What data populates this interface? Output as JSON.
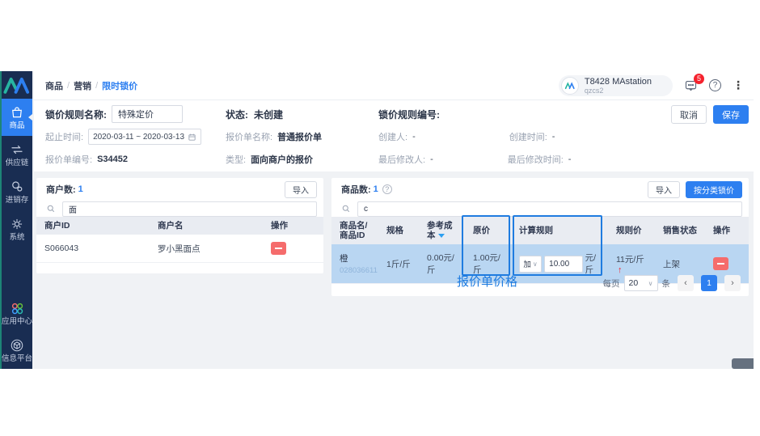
{
  "colors": {
    "accent": "#2d7ff0",
    "sidebar": "#192d52",
    "danger": "#f56c6c",
    "row_highlight": "#b9d6f2",
    "annotation": "#1f7ce0"
  },
  "sidebar": {
    "items": [
      {
        "label": "商品",
        "icon": "bag",
        "active": true
      },
      {
        "label": "供应链",
        "icon": "exchange-arrows",
        "active": false
      },
      {
        "label": "进销存",
        "icon": "nodes",
        "active": false
      },
      {
        "label": "系统",
        "icon": "gear",
        "active": false
      },
      {
        "label": "应用中心",
        "icon": "four-circles",
        "active": false
      },
      {
        "label": "信息平台",
        "icon": "cube",
        "active": false
      }
    ]
  },
  "topbar": {
    "breadcrumb": {
      "0": "商品",
      "1": "营销",
      "2": "限时锁价"
    },
    "user": {
      "name": "T8428 MAstation",
      "sub": "qzcs2"
    },
    "message_badge": "5"
  },
  "form": {
    "rule_name_label": "锁价规则名称:",
    "rule_name_value": "特殊定价",
    "status_label": "状态:",
    "status_value": "未创建",
    "rule_no_label": "锁价规则编号:",
    "date_label": "起止时间:",
    "date_value": "2020-03-11 ~ 2020-03-13",
    "quote_name_label": "报价单名称:",
    "quote_name_value": "普通报价单",
    "creator_label": "创建人:",
    "creator_value": "-",
    "created_label": "创建时间:",
    "created_value": "-",
    "quote_no_label": "报价单编号:",
    "quote_no_value": "S34452",
    "type_label": "类型:",
    "type_value": "面向商户的报价",
    "modifier_label": "最后修改人:",
    "modifier_value": "-",
    "modified_label": "最后修改时间:",
    "modified_value": "-",
    "cancel_label": "取消",
    "save_label": "保存"
  },
  "merchants": {
    "count_label": "商户数:",
    "count": "1",
    "import_label": "导入",
    "search_value": "面",
    "columns": {
      "0": "商户ID",
      "1": "商户名",
      "2": "操作"
    },
    "row": {
      "id": "S066043",
      "name": "罗小黑面点"
    }
  },
  "products": {
    "count_label": "商品数:",
    "count": "1",
    "import_label": "导入",
    "lock_by_category_label": "按分类锁价",
    "search_value": "c",
    "columns": {
      "0": "商品名/商品ID",
      "1": "规格",
      "2": "参考成本",
      "3": "原价",
      "4": "计算规则",
      "5": "规则价",
      "6": "销售状态",
      "7": "操作"
    },
    "row": {
      "name": "橙",
      "id": "028036611",
      "spec": "1斤/斤",
      "cost": "0.00元/斤",
      "original_price": "1.00元/斤",
      "calc_op": "加",
      "calc_value": "10.00",
      "calc_unit": "元/斤",
      "rule_price": "11元/斤",
      "sale_status": "上架"
    },
    "pagination": {
      "per_page_label": "每页",
      "per_page": "20",
      "unit_label": "条",
      "page": "1"
    }
  },
  "annotation": {
    "label": "报价单价格"
  }
}
